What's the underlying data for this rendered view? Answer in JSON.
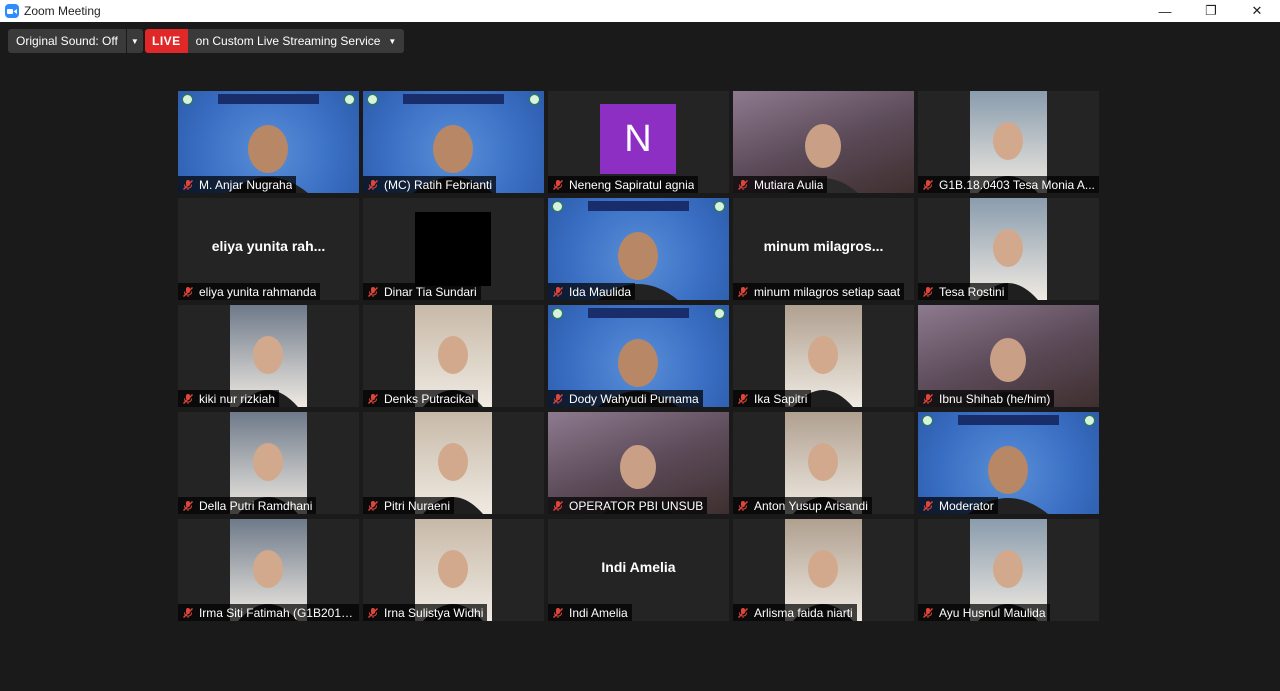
{
  "window": {
    "title": "Zoom Meeting",
    "controls": [
      "—",
      "❐",
      "✕"
    ]
  },
  "toolbar": {
    "original_sound": "Original Sound: Off",
    "live_badge": "LIVE",
    "live_text": "on Custom Live Streaming Service"
  },
  "colors": {
    "active_speaker_border": "#9bd34a",
    "live_red": "#e02828",
    "tile_bg": "#242424",
    "muted_icon": "#e0453a"
  },
  "participants": [
    {
      "name": "M. Anjar Nugraha",
      "video": "blue-bg"
    },
    {
      "name": "(MC) Ratih Febrianti",
      "video": "blue-bg",
      "active": true
    },
    {
      "name": "Neneng Sapiratul agnia",
      "avatar_letter": "N"
    },
    {
      "name": "Mutiara Aulia",
      "video": "room"
    },
    {
      "name": "G1B.18.0403 Tesa Monia A...",
      "video": "narrow-photo"
    },
    {
      "name": "eliya yunita rahmanda",
      "display_name": "eliya yunita rah..."
    },
    {
      "name": "Dinar Tia Sundari",
      "video": "black"
    },
    {
      "name": "Ida Maulida",
      "video": "blue-bg"
    },
    {
      "name": "minum milagros setiap saat",
      "display_name": "minum milagros..."
    },
    {
      "name": "Tesa Rostini",
      "video": "narrow-photo"
    },
    {
      "name": "kiki nur rizkiah",
      "video": "narrow-photo"
    },
    {
      "name": "Denks Putracikal",
      "video": "narrow-photo"
    },
    {
      "name": "Dody Wahyudi Purnama",
      "video": "blue-bg"
    },
    {
      "name": "Ika Sapitri",
      "video": "narrow-photo"
    },
    {
      "name": "Ibnu Shihab (he/him)",
      "video": "room"
    },
    {
      "name": "Della Putri Ramdhani",
      "video": "narrow-photo"
    },
    {
      "name": "Pitri Nuraeni",
      "video": "narrow-photo"
    },
    {
      "name": "OPERATOR PBI UNSUB",
      "video": "room"
    },
    {
      "name": "Anton Yusup Arisandi",
      "video": "narrow-photo"
    },
    {
      "name": "Moderator",
      "video": "blue-bg"
    },
    {
      "name": "Irma Siti Fatimah (G1B2010...",
      "video": "narrow-photo"
    },
    {
      "name": "Irna Sulistya Widhi",
      "video": "narrow-photo"
    },
    {
      "name": "Indi Amelia",
      "display_name": "Indi Amelia"
    },
    {
      "name": "Arlisma faida niarti",
      "video": "narrow-photo"
    },
    {
      "name": "Ayu Husnul Maulida",
      "video": "narrow-photo"
    }
  ],
  "icons": {
    "mic": "mic-muted-icon",
    "app": "zoom-app-icon"
  }
}
